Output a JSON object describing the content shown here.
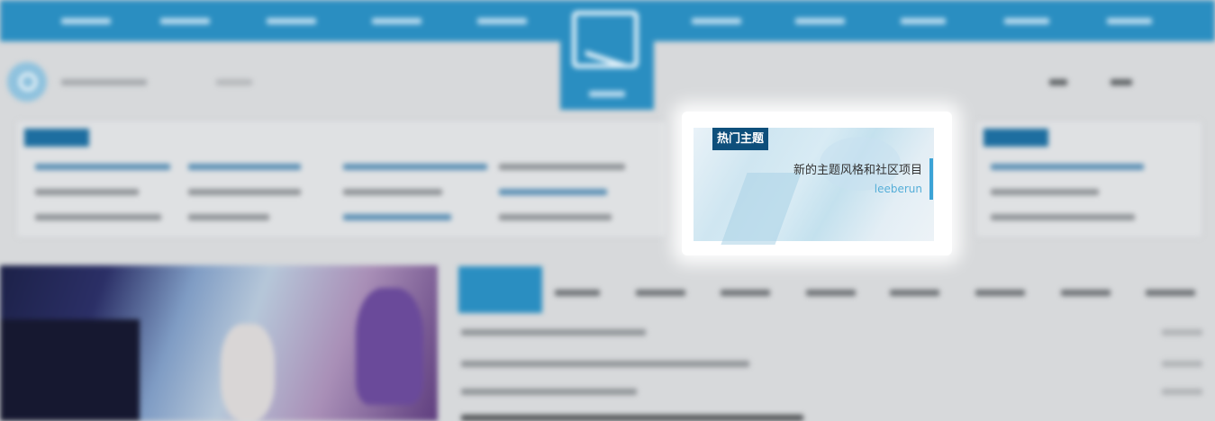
{
  "featured_card": {
    "section_label": "热门主题",
    "items": [
      {
        "title": "新的主题风格和社区项目",
        "author": "leeberun"
      }
    ]
  },
  "colors": {
    "nav_blue": "#2a8ec1",
    "label_dark_blue": "#0e4f7b",
    "author_blue": "#55aed8",
    "accent_blue": "#3ba3d6"
  },
  "icons": [
    "search-icon",
    "site-logo-icon"
  ]
}
